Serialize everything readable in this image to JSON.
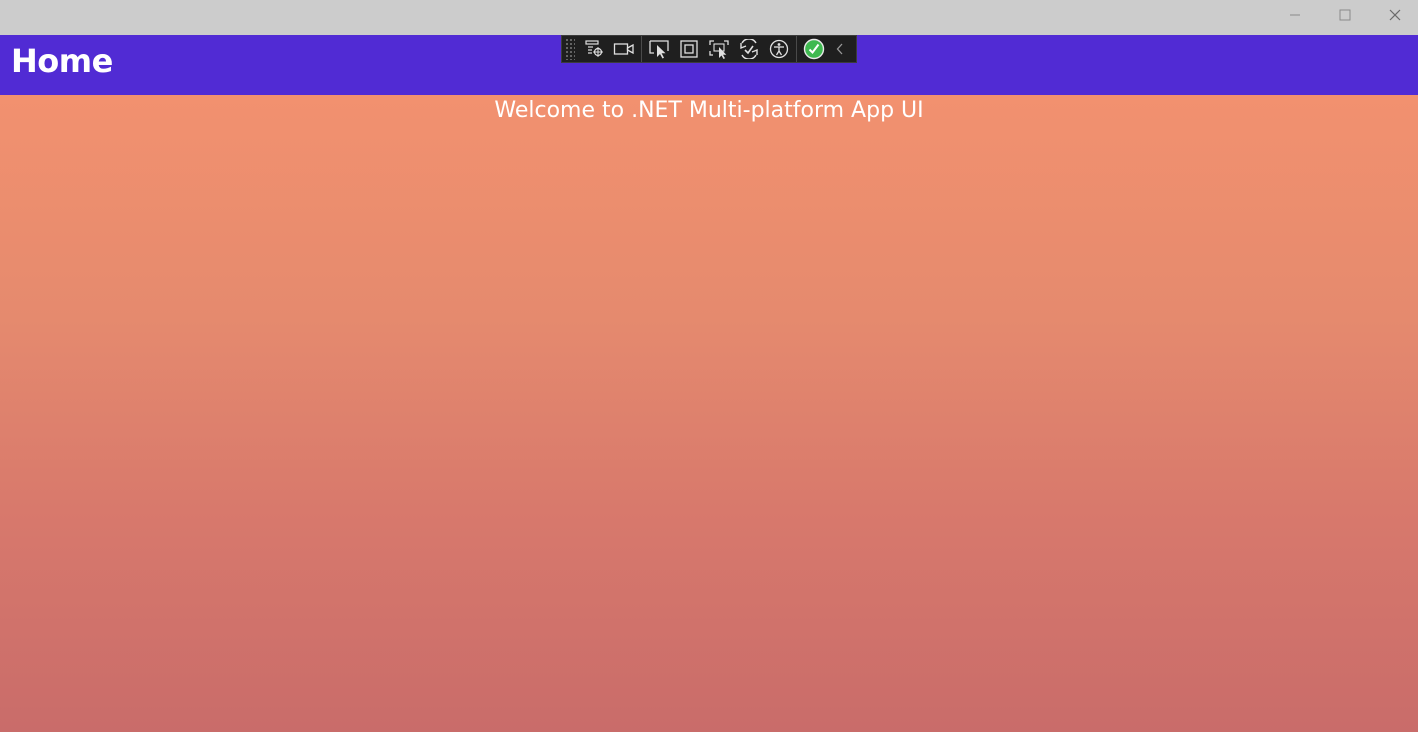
{
  "window": {
    "controls": {
      "minimize_icon": "minimize-icon",
      "maximize_icon": "maximize-icon",
      "close_icon": "close-icon"
    }
  },
  "navbar": {
    "title": "Home",
    "background": "#512bd4"
  },
  "content": {
    "welcome_text": "Welcome to .NET Multi-platform App UI",
    "gradient_top": "#f2916f",
    "gradient_bottom": "#c96c6a"
  },
  "dev_toolbar": {
    "buttons": [
      "live-visual-tree-icon",
      "record-video-icon",
      "select-element-icon",
      "display-layout-adorners-icon",
      "track-focus-icon",
      "hot-reload-icon",
      "accessibility-icon",
      "binding-failures-check-icon",
      "collapse-toolbar-icon"
    ],
    "status_color": "#3fb950"
  }
}
